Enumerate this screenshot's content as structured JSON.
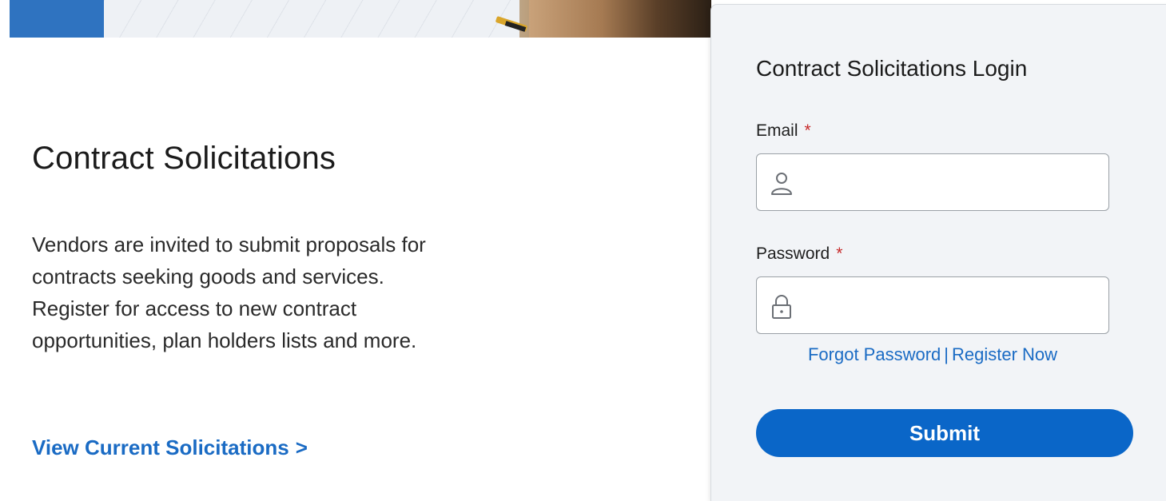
{
  "hero": {
    "image_name": "construction-plans-banner"
  },
  "main": {
    "title": "Contract Solicitations",
    "intro_lines": [
      "Vendors are invited to submit proposals for",
      "contracts seeking goods and services.",
      "Register for access to new contract",
      "opportunities, plan holders lists and more."
    ],
    "view_link": {
      "label": "View Current Solicitations",
      "chevron": ">"
    }
  },
  "login": {
    "title": "Contract Solicitations Login",
    "required_marker": "*",
    "email": {
      "label": "Email",
      "value": "",
      "placeholder": "",
      "icon": "user-icon"
    },
    "password": {
      "label": "Password",
      "value": "",
      "placeholder": "",
      "icon": "lock-icon"
    },
    "forgot_password_label": "Forgot Password",
    "separator": "|",
    "register_label": "Register Now",
    "submit_label": "Submit"
  },
  "colors": {
    "link": "#1a6bc4",
    "primary_button": "#0a66c8",
    "panel_bg": "#f2f4f7",
    "required": "#c62828"
  }
}
